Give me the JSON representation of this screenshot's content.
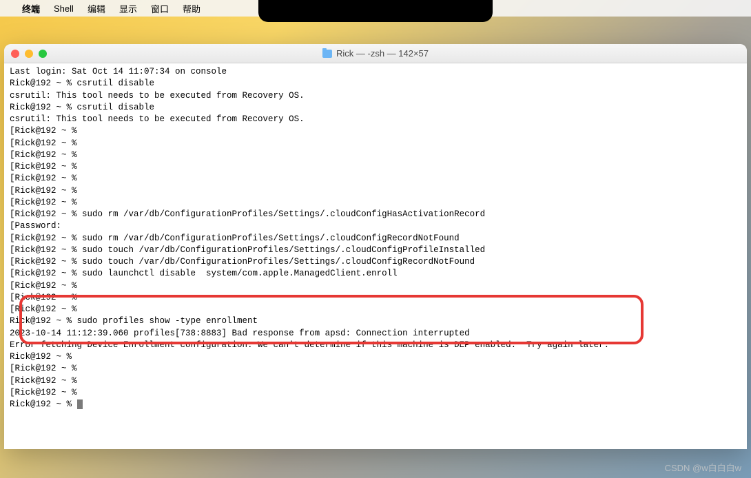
{
  "menu": {
    "app": "终端",
    "items": [
      "Shell",
      "编辑",
      "显示",
      "窗口",
      "帮助"
    ]
  },
  "window": {
    "title": "Rick — -zsh — 142×57"
  },
  "terminal": {
    "lines": [
      "Last login: Sat Oct 14 11:07:34 on console",
      "Rick@192 ~ % csrutil disable",
      "csrutil: This tool needs to be executed from Recovery OS.",
      "Rick@192 ~ % csrutil disable",
      "csrutil: This tool needs to be executed from Recovery OS.",
      "[Rick@192 ~ %",
      "[Rick@192 ~ %",
      "[Rick@192 ~ %",
      "[Rick@192 ~ %",
      "[Rick@192 ~ %",
      "[Rick@192 ~ %",
      "[Rick@192 ~ %",
      "[Rick@192 ~ % sudo rm /var/db/ConfigurationProfiles/Settings/.cloudConfigHasActivationRecord",
      "[Password:",
      "[Rick@192 ~ % sudo rm /var/db/ConfigurationProfiles/Settings/.cloudConfigRecordNotFound",
      "[Rick@192 ~ % sudo touch /var/db/ConfigurationProfiles/Settings/.cloudConfigProfileInstalled",
      "[Rick@192 ~ % sudo touch /var/db/ConfigurationProfiles/Settings/.cloudConfigRecordNotFound",
      "[Rick@192 ~ % sudo launchctl disable  system/com.apple.ManagedClient.enroll",
      "[Rick@192 ~ %",
      "[Rick@192 ~ %",
      "[Rick@192 ~ %",
      "",
      "Rick@192 ~ % sudo profiles show -type enrollment",
      "2023-10-14 11:12:39.060 profiles[738:8883] Bad response from apsd: Connection interrupted",
      "Error fetching Device Enrollment configuration: We can't determine if this machine is DEP enabled.  Try again later.",
      "Rick@192 ~ %",
      "[Rick@192 ~ %",
      "[Rick@192 ~ %",
      "[Rick@192 ~ %",
      "Rick@192 ~ % "
    ]
  },
  "watermark": "CSDN @w白白白w"
}
